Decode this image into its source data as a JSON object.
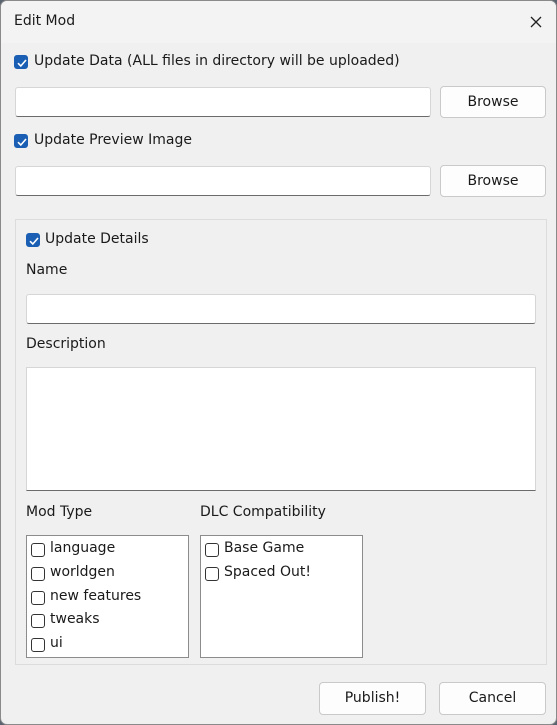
{
  "window": {
    "title": "Edit Mod"
  },
  "data_section": {
    "checkbox_label": "Update Data (ALL files in directory will be uploaded)",
    "checked": true,
    "path_value": "",
    "browse_label": "Browse"
  },
  "preview_section": {
    "checkbox_label": "Update Preview Image",
    "checked": true,
    "path_value": "",
    "browse_label": "Browse"
  },
  "details": {
    "checkbox_label": "Update Details",
    "checked": true,
    "name_label": "Name",
    "name_value": "",
    "description_label": "Description",
    "description_value": "",
    "mod_type_label": "Mod Type",
    "mod_types": [
      {
        "label": "language",
        "checked": false
      },
      {
        "label": "worldgen",
        "checked": false
      },
      {
        "label": "new features",
        "checked": false
      },
      {
        "label": "tweaks",
        "checked": false
      },
      {
        "label": "ui",
        "checked": false
      }
    ],
    "dlc_label": "DLC Compatibility",
    "dlc_options": [
      {
        "label": "Base Game",
        "checked": false
      },
      {
        "label": "Spaced Out!",
        "checked": false
      }
    ]
  },
  "footer": {
    "publish_label": "Publish!",
    "cancel_label": "Cancel"
  },
  "colors": {
    "accent": "#1a5fb4"
  }
}
